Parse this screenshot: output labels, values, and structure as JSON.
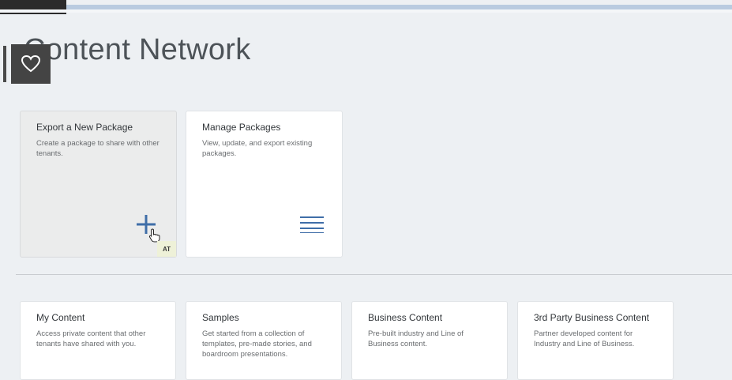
{
  "page": {
    "title": "Content Network"
  },
  "top_tiles": [
    {
      "title": "Export a New Package",
      "description": "Create a package to share with other tenants.",
      "icon": "plus-icon",
      "badge": "AT"
    },
    {
      "title": "Manage Packages",
      "description": "View, update, and export existing packages.",
      "icon": "list-icon"
    }
  ],
  "bottom_tiles": [
    {
      "title": "My Content",
      "description": "Access private content that other tenants have shared with you."
    },
    {
      "title": "Samples",
      "description": "Get started from a collection of templates, pre-made stories, and boardroom presentations."
    },
    {
      "title": "Business Content",
      "description": "Pre-built industry and Line of Business content."
    },
    {
      "title": "3rd Party Business Content",
      "description": "Partner developed content for Industry and Line of Business."
    }
  ],
  "colors": {
    "accent": "#3f6ea8",
    "background": "#edf0f3",
    "tile": "#ffffff"
  }
}
